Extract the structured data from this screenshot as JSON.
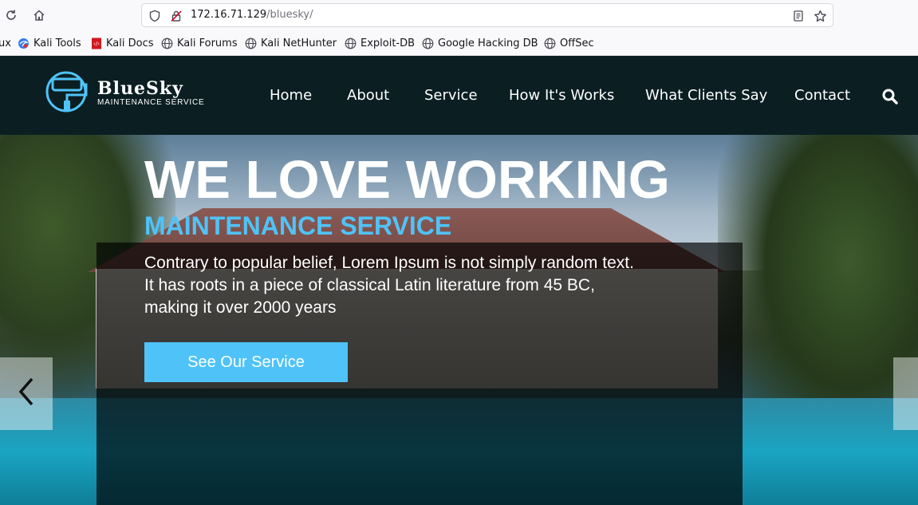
{
  "browser": {
    "url_host": "172.16.71.129",
    "url_path": "/bluesky/",
    "bookmarks": [
      {
        "label": "ux",
        "icon": "truncated"
      },
      {
        "label": "Kali Tools",
        "icon": "kali-tools-icon"
      },
      {
        "label": "Kali Docs",
        "icon": "kali-docs-icon"
      },
      {
        "label": "Kali Forums",
        "icon": "globe-icon"
      },
      {
        "label": "Kali NetHunter",
        "icon": "globe-icon"
      },
      {
        "label": "Exploit-DB",
        "icon": "globe-icon"
      },
      {
        "label": "Google Hacking DB",
        "icon": "globe-icon"
      },
      {
        "label": "OffSec",
        "icon": "globe-icon"
      }
    ]
  },
  "site": {
    "logo": {
      "name": "BlueSky",
      "tagline": "Maintenance Service"
    },
    "nav": [
      "Home",
      "About",
      "Service",
      "How It's Works",
      "What Clients Say",
      "Contact"
    ],
    "colors": {
      "header_bg": "#0b1f23",
      "accent": "#4fc3f7"
    }
  },
  "hero": {
    "title": "WE LOVE WORKING",
    "subtitle": "MAINTENANCE SERVICE",
    "text_lines": [
      "Contrary to popular belief, Lorem Ipsum is not simply random text.",
      "It has roots in a piece of classical Latin literature from 45 BC,",
      "making it over 2000 years"
    ],
    "cta_label": "See Our Service"
  }
}
